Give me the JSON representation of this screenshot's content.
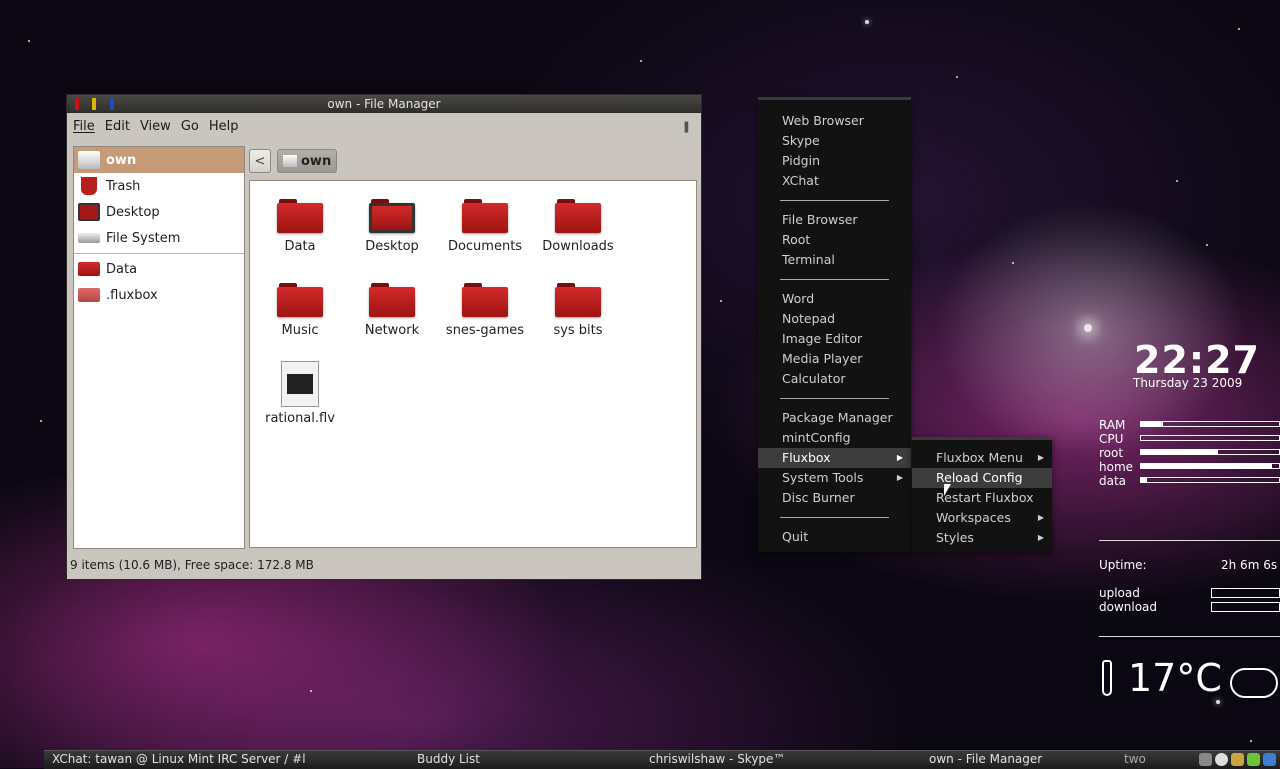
{
  "file_manager": {
    "title": "own - File Manager",
    "menu": [
      "File",
      "Edit",
      "View",
      "Go",
      "Help"
    ],
    "sidebar": [
      {
        "label": "own",
        "icon": "home-icon",
        "selected": true
      },
      {
        "label": "Trash",
        "icon": "trash-icon"
      },
      {
        "label": "Desktop",
        "icon": "desktop-icon"
      },
      {
        "label": "File System",
        "icon": "drive-icon"
      },
      {
        "label": "Data",
        "icon": "folder-icon"
      },
      {
        "label": ".fluxbox",
        "icon": "folder-icon"
      }
    ],
    "path_crumb": "own",
    "items": [
      {
        "label": "Data",
        "icon": "folder-icon"
      },
      {
        "label": "Desktop",
        "icon": "desktop-folder-icon"
      },
      {
        "label": "Documents",
        "icon": "folder-icon"
      },
      {
        "label": "Downloads",
        "icon": "folder-icon"
      },
      {
        "label": "Music",
        "icon": "folder-icon"
      },
      {
        "label": "Network",
        "icon": "folder-icon"
      },
      {
        "label": "snes-games",
        "icon": "folder-icon"
      },
      {
        "label": "sys bits",
        "icon": "folder-icon"
      },
      {
        "label": "rational.flv",
        "icon": "video-file-icon"
      }
    ],
    "status": "9 items (10.6 MB), Free space: 172.8 MB"
  },
  "root_menu": {
    "groups": [
      [
        "Web Browser",
        "Skype",
        "Pidgin",
        "XChat"
      ],
      [
        "File Browser",
        "Root",
        "Terminal"
      ],
      [
        "Word",
        "Notepad",
        "Image Editor",
        "Media Player",
        "Calculator"
      ],
      [
        "Package Manager",
        "mintConfig",
        "Fluxbox",
        "System Tools",
        "Disc Burner"
      ],
      [
        "Quit"
      ]
    ],
    "active": "Fluxbox"
  },
  "fluxbox_submenu": {
    "items": [
      "Fluxbox Menu",
      "Reload Config",
      "Restart Fluxbox",
      "Workspaces",
      "Styles"
    ],
    "active": "Reload Config"
  },
  "conky": {
    "time": "22:27",
    "date": "Thursday 23 2009",
    "stats": [
      {
        "label": "RAM",
        "percent": 16
      },
      {
        "label": "CPU",
        "percent": 0
      },
      {
        "label": "root",
        "percent": 56
      },
      {
        "label": "home",
        "percent": 95
      },
      {
        "label": "data",
        "percent": 4
      }
    ],
    "uptime_label": "Uptime:",
    "uptime_value": "2h 6m 6s",
    "net": [
      "upload",
      "download"
    ],
    "temperature": "17°C"
  },
  "taskbar": {
    "tasks": [
      "XChat: tawan @ Linux Mint IRC Server / #l",
      "Buddy List",
      "chriswilshaw - Skype™",
      "own - File Manager"
    ],
    "workspace": "two"
  }
}
